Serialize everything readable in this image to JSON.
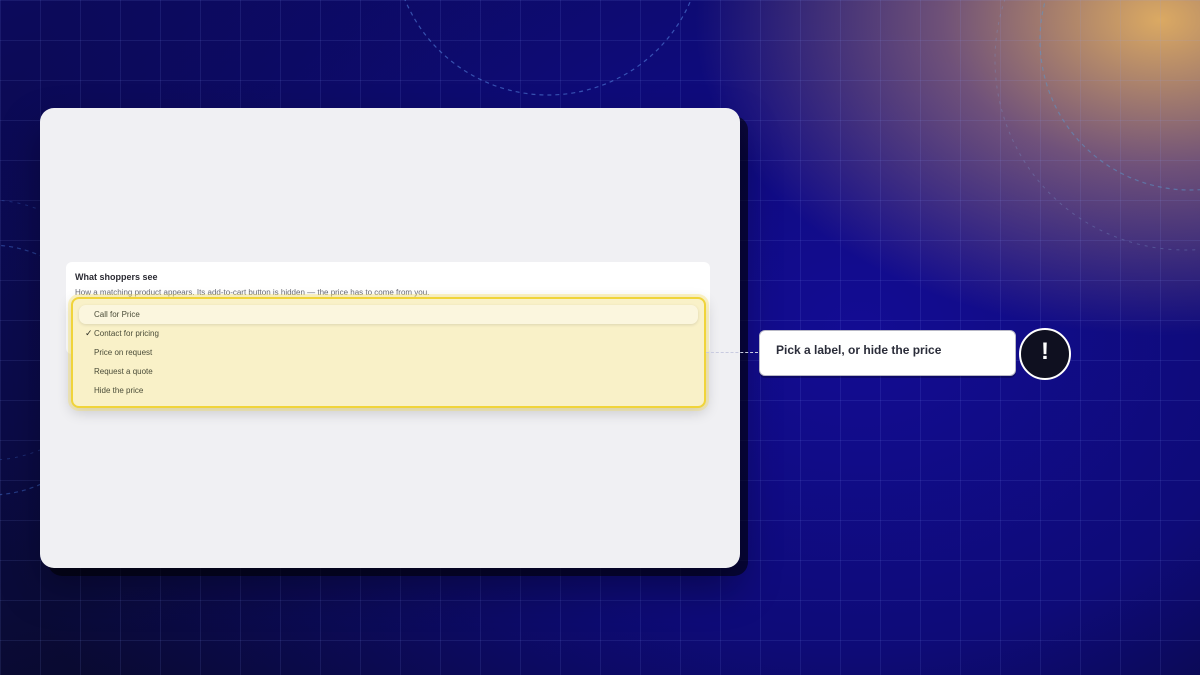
{
  "card": {
    "title": "What shoppers see",
    "description": "How a matching product appears. Its add-to-cart button is hidden — the price has to come from you."
  },
  "dropdown": {
    "selected": "Contact for pricing",
    "options": [
      {
        "label": "Call for Price",
        "checked": false
      },
      {
        "label": "Contact for pricing",
        "checked": true
      },
      {
        "label": "Price on request",
        "checked": false
      },
      {
        "label": "Request a quote",
        "checked": false
      },
      {
        "label": "Hide the price",
        "checked": false
      }
    ],
    "check_glyph": "✓"
  },
  "callout": {
    "text": "Pick a label, or hide the price",
    "badge": "!",
    "badge_icon": "exclamation-icon"
  },
  "colors": {
    "highlight_border": "#f0d43a",
    "highlight_fill": "#f9f1c8",
    "badge_bg": "#0f1020"
  }
}
